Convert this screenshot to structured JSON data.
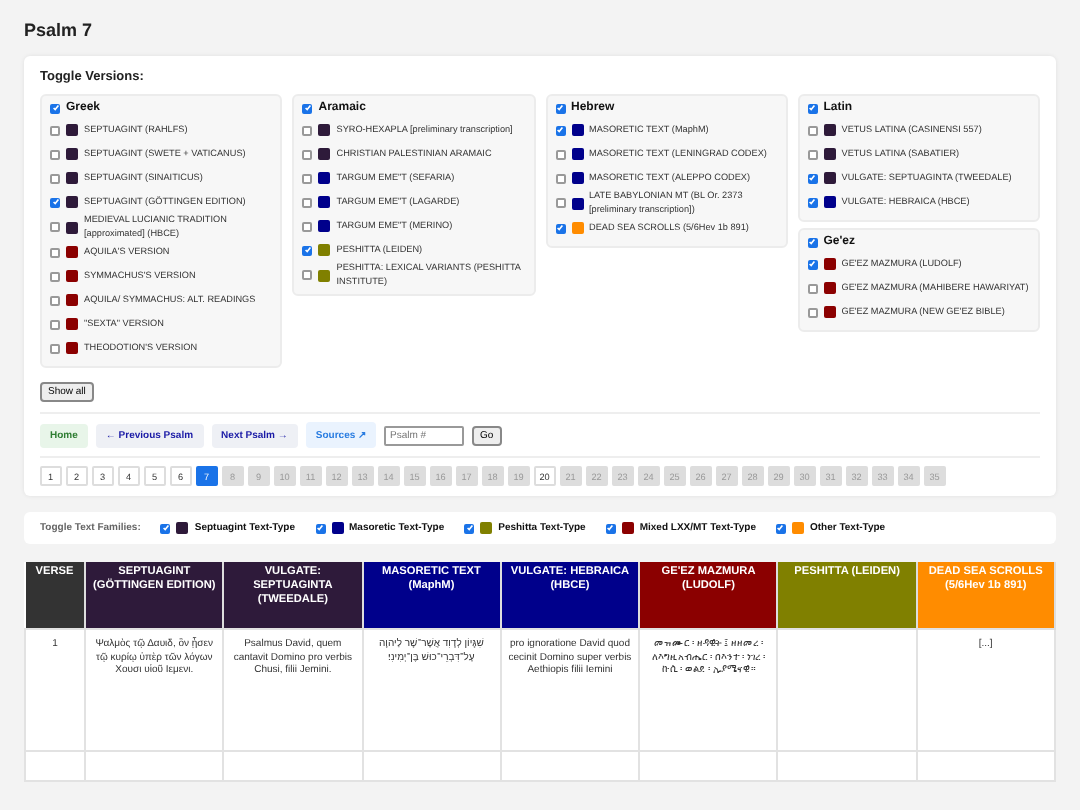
{
  "page_title": "Psalm 7",
  "versions": {
    "title": "Toggle Versions:",
    "show_all": "Show all",
    "columns": [
      {
        "groups": [
          {
            "name": "Greek",
            "checked": true,
            "items": [
              {
                "label": "SEPTUAGINT (RAHLFS)",
                "checked": false,
                "color": "#2e1a3a"
              },
              {
                "label": "SEPTUAGINT (SWETE + VATICANUS)",
                "checked": false,
                "color": "#2e1a3a"
              },
              {
                "label": "SEPTUAGINT (SINAITICUS)",
                "checked": false,
                "color": "#2e1a3a"
              },
              {
                "label": "SEPTUAGINT (GÖTTINGEN EDITION)",
                "checked": true,
                "color": "#2e1a3a"
              },
              {
                "label": "MEDIEVAL LUCIANIC TRADITION [approximated] (HBCE)",
                "checked": false,
                "color": "#2e1a3a"
              },
              {
                "label": "AQUILA'S VERSION",
                "checked": false,
                "color": "#8b0000"
              },
              {
                "label": "SYMMACHUS'S VERSION",
                "checked": false,
                "color": "#8b0000"
              },
              {
                "label": "AQUILA/ SYMMACHUS: ALT. READINGS",
                "checked": false,
                "color": "#8b0000"
              },
              {
                "label": "\"SEXTA\" VERSION",
                "checked": false,
                "color": "#8b0000"
              },
              {
                "label": "THEODOTION'S VERSION",
                "checked": false,
                "color": "#8b0000"
              }
            ]
          }
        ]
      },
      {
        "groups": [
          {
            "name": "Aramaic",
            "checked": true,
            "items": [
              {
                "label": "SYRO-HEXAPLA [preliminary transcription]",
                "checked": false,
                "color": "#2e1a3a"
              },
              {
                "label": "CHRISTIAN PALESTINIAN ARAMAIC",
                "checked": false,
                "color": "#2e1a3a"
              },
              {
                "label": "TARGUM EME\"T (SEFARIA)",
                "checked": false,
                "color": "#00008b"
              },
              {
                "label": "TARGUM EME\"T (LAGARDE)",
                "checked": false,
                "color": "#00008b"
              },
              {
                "label": "TARGUM EME\"T (MERINO)",
                "checked": false,
                "color": "#00008b"
              },
              {
                "label": "PESHITTA (LEIDEN)",
                "checked": true,
                "color": "#808000"
              },
              {
                "label": "PESHITTA: LEXICAL VARIANTS (PESHITTA INSTITUTE)",
                "checked": false,
                "color": "#808000"
              }
            ]
          }
        ]
      },
      {
        "groups": [
          {
            "name": "Hebrew",
            "checked": true,
            "items": [
              {
                "label": "MASORETIC TEXT (MaphM)",
                "checked": true,
                "color": "#00008b"
              },
              {
                "label": "MASORETIC TEXT (LENINGRAD CODEX)",
                "checked": false,
                "color": "#00008b"
              },
              {
                "label": "MASORETIC TEXT (ALEPPO CODEX)",
                "checked": false,
                "color": "#00008b"
              },
              {
                "label": "LATE BABYLONIAN MT (BL Or. 2373 [preliminary transcription])",
                "checked": false,
                "color": "#00008b"
              },
              {
                "label": "DEAD SEA SCROLLS (5/6Hev 1b 891)",
                "checked": true,
                "color": "#ff8c00"
              }
            ]
          }
        ]
      },
      {
        "groups": [
          {
            "name": "Latin",
            "checked": true,
            "items": [
              {
                "label": "VETUS LATINA (CASINENSI 557)",
                "checked": false,
                "color": "#2e1a3a"
              },
              {
                "label": "VETUS LATINA (SABATIER)",
                "checked": false,
                "color": "#2e1a3a"
              },
              {
                "label": "VULGATE: SEPTUAGINTA (TWEEDALE)",
                "checked": true,
                "color": "#2e1a3a"
              },
              {
                "label": "VULGATE: HEBRAICA (HBCE)",
                "checked": true,
                "color": "#00008b"
              }
            ]
          },
          {
            "name": "Ge'ez",
            "checked": true,
            "items": [
              {
                "label": "GE'EZ MAZMURA (LUDOLF)",
                "checked": true,
                "color": "#8b0000"
              },
              {
                "label": "GE'EZ MAZMURA (MAHIBERE HAWARIYAT)",
                "checked": false,
                "color": "#8b0000"
              },
              {
                "label": "GE'EZ MAZMURA (NEW GE'EZ BIBLE)",
                "checked": false,
                "color": "#8b0000"
              }
            ]
          }
        ]
      }
    ]
  },
  "nav": {
    "links": [
      {
        "label": "Home",
        "kind": "home"
      },
      {
        "label": "← Previous Psalm",
        "kind": "step"
      },
      {
        "label": "Next Psalm →",
        "kind": "step"
      },
      {
        "label": "Sources ↗",
        "kind": "external"
      }
    ],
    "psalm_field": {
      "placeholder": "Psalm #"
    },
    "go_button": "Go"
  },
  "pages": [
    {
      "label": "1",
      "selected": false,
      "disabled": false
    },
    {
      "label": "2",
      "selected": false,
      "disabled": false
    },
    {
      "label": "3",
      "selected": false,
      "disabled": false
    },
    {
      "label": "4",
      "selected": false,
      "disabled": false
    },
    {
      "label": "5",
      "selected": false,
      "disabled": false
    },
    {
      "label": "6",
      "selected": false,
      "disabled": false
    },
    {
      "label": "7",
      "selected": true,
      "disabled": false
    },
    {
      "label": "8",
      "selected": false,
      "disabled": true
    },
    {
      "label": "9",
      "selected": false,
      "disabled": true
    },
    {
      "label": "10",
      "selected": false,
      "disabled": true
    },
    {
      "label": "11",
      "selected": false,
      "disabled": true
    },
    {
      "label": "12",
      "selected": false,
      "disabled": true
    },
    {
      "label": "13",
      "selected": false,
      "disabled": true
    },
    {
      "label": "14",
      "selected": false,
      "disabled": true
    },
    {
      "label": "15",
      "selected": false,
      "disabled": true
    },
    {
      "label": "16",
      "selected": false,
      "disabled": true
    },
    {
      "label": "17",
      "selected": false,
      "disabled": true
    },
    {
      "label": "18",
      "selected": false,
      "disabled": true
    },
    {
      "label": "19",
      "selected": false,
      "disabled": true
    },
    {
      "label": "20",
      "selected": false,
      "disabled": false
    },
    {
      "label": "21",
      "selected": false,
      "disabled": true
    },
    {
      "label": "22",
      "selected": false,
      "disabled": true
    },
    {
      "label": "23",
      "selected": false,
      "disabled": true
    },
    {
      "label": "24",
      "selected": false,
      "disabled": true
    },
    {
      "label": "25",
      "selected": false,
      "disabled": true
    },
    {
      "label": "26",
      "selected": false,
      "disabled": true
    },
    {
      "label": "27",
      "selected": false,
      "disabled": true
    },
    {
      "label": "28",
      "selected": false,
      "disabled": true
    },
    {
      "label": "29",
      "selected": false,
      "disabled": true
    },
    {
      "label": "30",
      "selected": false,
      "disabled": true
    },
    {
      "label": "31",
      "selected": false,
      "disabled": true
    },
    {
      "label": "32",
      "selected": false,
      "disabled": true
    },
    {
      "label": "33",
      "selected": false,
      "disabled": true
    },
    {
      "label": "34",
      "selected": false,
      "disabled": true
    },
    {
      "label": "35",
      "selected": false,
      "disabled": true
    }
  ],
  "families": {
    "title": "Toggle Text Families:",
    "items": [
      {
        "label": "Septuagint Text-Type",
        "checked": true,
        "color": "#2e1a3a"
      },
      {
        "label": "Masoretic Text-Type",
        "checked": true,
        "color": "#00008b"
      },
      {
        "label": "Peshitta Text-Type",
        "checked": true,
        "color": "#808000"
      },
      {
        "label": "Mixed LXX/MT Text-Type",
        "checked": true,
        "color": "#8b0000"
      },
      {
        "label": "Other Text-Type",
        "checked": true,
        "color": "#ff8c00"
      }
    ]
  },
  "table": {
    "columns": [
      {
        "label": "VERSE",
        "color": "#333333"
      },
      {
        "label": "SEPTUAGINT (GÖTTINGEN EDITION)",
        "color": "#2e1a3a"
      },
      {
        "label": "VULGATE: SEPTUAGINTA (TWEEDALE)",
        "color": "#2e1a3a"
      },
      {
        "label": "MASORETIC TEXT (MaphM)",
        "color": "#00008b"
      },
      {
        "label": "VULGATE: HEBRAICA (HBCE)",
        "color": "#00008b"
      },
      {
        "label": "GE'EZ MAZMURA (LUDOLF)",
        "color": "#8b0000"
      },
      {
        "label": "PESHITTA (LEIDEN)",
        "color": "#808000"
      },
      {
        "label": "DEAD SEA SCROLLS (5/6Hev 1b 891)",
        "color": "#ff8c00"
      }
    ],
    "rows": [
      {
        "cells": [
          "1",
          "Ψαλμὸς τῷ Δαυιδ, ὃν ᾖσεν τῷ κυρίῳ ὑπὲρ τῶν λόγων Χουσι υἱοῦ Ιεμενι.",
          "Psalmus David, quem cantavit Domino pro verbis Chusi, filii Jemini.",
          "שִׁגָּיוֹן לְדָוִד אֲשֶׁר־שָׁר לַיהוָה עַל־דִּבְרֵי־כוּשׁ בֶּן־יְמִינִי׃",
          "pro ignoratione David quod cecinit Domino super verbis Aethiopis filii Iemini",
          "መዝሙር ፡ ዘዳዊት ፤ ዘዘመረ ፡ ለእግዚአብሔር ፡ በእንተ ፡ ነገረ ፡ ኩሲ ፡ ወልደ ፡ ኢያሜናዊ ።",
          "",
          "[...]"
        ]
      }
    ]
  }
}
